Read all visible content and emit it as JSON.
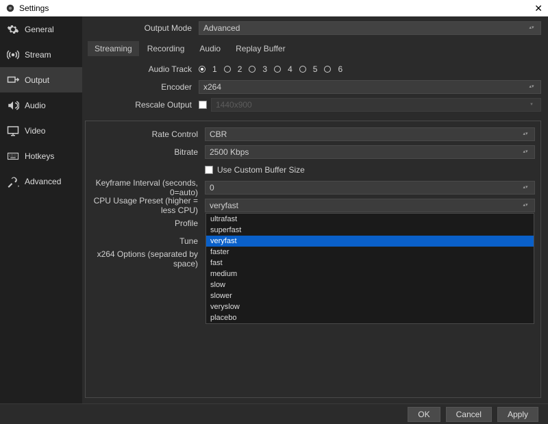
{
  "window": {
    "title": "Settings"
  },
  "sidebar": {
    "items": [
      {
        "label": "General"
      },
      {
        "label": "Stream"
      },
      {
        "label": "Output"
      },
      {
        "label": "Audio"
      },
      {
        "label": "Video"
      },
      {
        "label": "Hotkeys"
      },
      {
        "label": "Advanced"
      }
    ]
  },
  "output_mode": {
    "label": "Output Mode",
    "value": "Advanced"
  },
  "tabs": {
    "streaming": "Streaming",
    "recording": "Recording",
    "audio": "Audio",
    "replay_buffer": "Replay Buffer"
  },
  "audio_track": {
    "label": "Audio Track",
    "options": [
      "1",
      "2",
      "3",
      "4",
      "5",
      "6"
    ],
    "selected_index": 0
  },
  "encoder": {
    "label": "Encoder",
    "value": "x264"
  },
  "rescale": {
    "label": "Rescale Output",
    "placeholder": "1440x900"
  },
  "rate_control": {
    "label": "Rate Control",
    "value": "CBR"
  },
  "bitrate": {
    "label": "Bitrate",
    "value": "2500 Kbps"
  },
  "custom_buffer": {
    "label": "Use Custom Buffer Size"
  },
  "keyframe": {
    "label": "Keyframe Interval (seconds, 0=auto)",
    "value": "0"
  },
  "cpu_preset": {
    "label": "CPU Usage Preset (higher = less CPU)",
    "value": "veryfast",
    "options": [
      "ultrafast",
      "superfast",
      "veryfast",
      "faster",
      "fast",
      "medium",
      "slow",
      "slower",
      "veryslow",
      "placebo"
    ],
    "highlight": "veryfast"
  },
  "profile": {
    "label": "Profile"
  },
  "tune": {
    "label": "Tune"
  },
  "x264_options": {
    "label": "x264 Options (separated by space)"
  },
  "buttons": {
    "ok": "OK",
    "cancel": "Cancel",
    "apply": "Apply"
  }
}
